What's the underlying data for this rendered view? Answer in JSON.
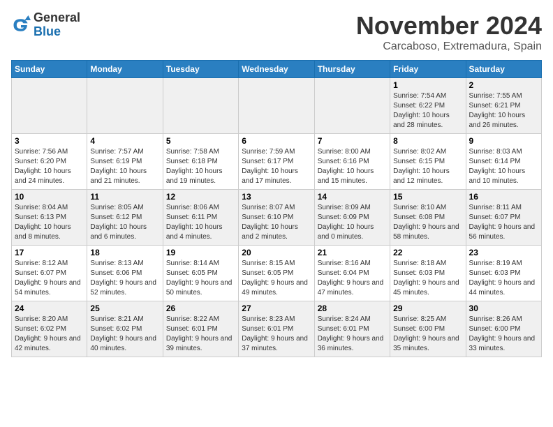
{
  "header": {
    "logo_line1": "General",
    "logo_line2": "Blue",
    "month_title": "November 2024",
    "subtitle": "Carcaboso, Extremadura, Spain"
  },
  "calendar": {
    "days_of_week": [
      "Sunday",
      "Monday",
      "Tuesday",
      "Wednesday",
      "Thursday",
      "Friday",
      "Saturday"
    ],
    "weeks": [
      [
        {
          "day": "",
          "info": ""
        },
        {
          "day": "",
          "info": ""
        },
        {
          "day": "",
          "info": ""
        },
        {
          "day": "",
          "info": ""
        },
        {
          "day": "",
          "info": ""
        },
        {
          "day": "1",
          "info": "Sunrise: 7:54 AM\nSunset: 6:22 PM\nDaylight: 10 hours and 28 minutes."
        },
        {
          "day": "2",
          "info": "Sunrise: 7:55 AM\nSunset: 6:21 PM\nDaylight: 10 hours and 26 minutes."
        }
      ],
      [
        {
          "day": "3",
          "info": "Sunrise: 7:56 AM\nSunset: 6:20 PM\nDaylight: 10 hours and 24 minutes."
        },
        {
          "day": "4",
          "info": "Sunrise: 7:57 AM\nSunset: 6:19 PM\nDaylight: 10 hours and 21 minutes."
        },
        {
          "day": "5",
          "info": "Sunrise: 7:58 AM\nSunset: 6:18 PM\nDaylight: 10 hours and 19 minutes."
        },
        {
          "day": "6",
          "info": "Sunrise: 7:59 AM\nSunset: 6:17 PM\nDaylight: 10 hours and 17 minutes."
        },
        {
          "day": "7",
          "info": "Sunrise: 8:00 AM\nSunset: 6:16 PM\nDaylight: 10 hours and 15 minutes."
        },
        {
          "day": "8",
          "info": "Sunrise: 8:02 AM\nSunset: 6:15 PM\nDaylight: 10 hours and 12 minutes."
        },
        {
          "day": "9",
          "info": "Sunrise: 8:03 AM\nSunset: 6:14 PM\nDaylight: 10 hours and 10 minutes."
        }
      ],
      [
        {
          "day": "10",
          "info": "Sunrise: 8:04 AM\nSunset: 6:13 PM\nDaylight: 10 hours and 8 minutes."
        },
        {
          "day": "11",
          "info": "Sunrise: 8:05 AM\nSunset: 6:12 PM\nDaylight: 10 hours and 6 minutes."
        },
        {
          "day": "12",
          "info": "Sunrise: 8:06 AM\nSunset: 6:11 PM\nDaylight: 10 hours and 4 minutes."
        },
        {
          "day": "13",
          "info": "Sunrise: 8:07 AM\nSunset: 6:10 PM\nDaylight: 10 hours and 2 minutes."
        },
        {
          "day": "14",
          "info": "Sunrise: 8:09 AM\nSunset: 6:09 PM\nDaylight: 10 hours and 0 minutes."
        },
        {
          "day": "15",
          "info": "Sunrise: 8:10 AM\nSunset: 6:08 PM\nDaylight: 9 hours and 58 minutes."
        },
        {
          "day": "16",
          "info": "Sunrise: 8:11 AM\nSunset: 6:07 PM\nDaylight: 9 hours and 56 minutes."
        }
      ],
      [
        {
          "day": "17",
          "info": "Sunrise: 8:12 AM\nSunset: 6:07 PM\nDaylight: 9 hours and 54 minutes."
        },
        {
          "day": "18",
          "info": "Sunrise: 8:13 AM\nSunset: 6:06 PM\nDaylight: 9 hours and 52 minutes."
        },
        {
          "day": "19",
          "info": "Sunrise: 8:14 AM\nSunset: 6:05 PM\nDaylight: 9 hours and 50 minutes."
        },
        {
          "day": "20",
          "info": "Sunrise: 8:15 AM\nSunset: 6:05 PM\nDaylight: 9 hours and 49 minutes."
        },
        {
          "day": "21",
          "info": "Sunrise: 8:16 AM\nSunset: 6:04 PM\nDaylight: 9 hours and 47 minutes."
        },
        {
          "day": "22",
          "info": "Sunrise: 8:18 AM\nSunset: 6:03 PM\nDaylight: 9 hours and 45 minutes."
        },
        {
          "day": "23",
          "info": "Sunrise: 8:19 AM\nSunset: 6:03 PM\nDaylight: 9 hours and 44 minutes."
        }
      ],
      [
        {
          "day": "24",
          "info": "Sunrise: 8:20 AM\nSunset: 6:02 PM\nDaylight: 9 hours and 42 minutes."
        },
        {
          "day": "25",
          "info": "Sunrise: 8:21 AM\nSunset: 6:02 PM\nDaylight: 9 hours and 40 minutes."
        },
        {
          "day": "26",
          "info": "Sunrise: 8:22 AM\nSunset: 6:01 PM\nDaylight: 9 hours and 39 minutes."
        },
        {
          "day": "27",
          "info": "Sunrise: 8:23 AM\nSunset: 6:01 PM\nDaylight: 9 hours and 37 minutes."
        },
        {
          "day": "28",
          "info": "Sunrise: 8:24 AM\nSunset: 6:01 PM\nDaylight: 9 hours and 36 minutes."
        },
        {
          "day": "29",
          "info": "Sunrise: 8:25 AM\nSunset: 6:00 PM\nDaylight: 9 hours and 35 minutes."
        },
        {
          "day": "30",
          "info": "Sunrise: 8:26 AM\nSunset: 6:00 PM\nDaylight: 9 hours and 33 minutes."
        }
      ]
    ]
  }
}
